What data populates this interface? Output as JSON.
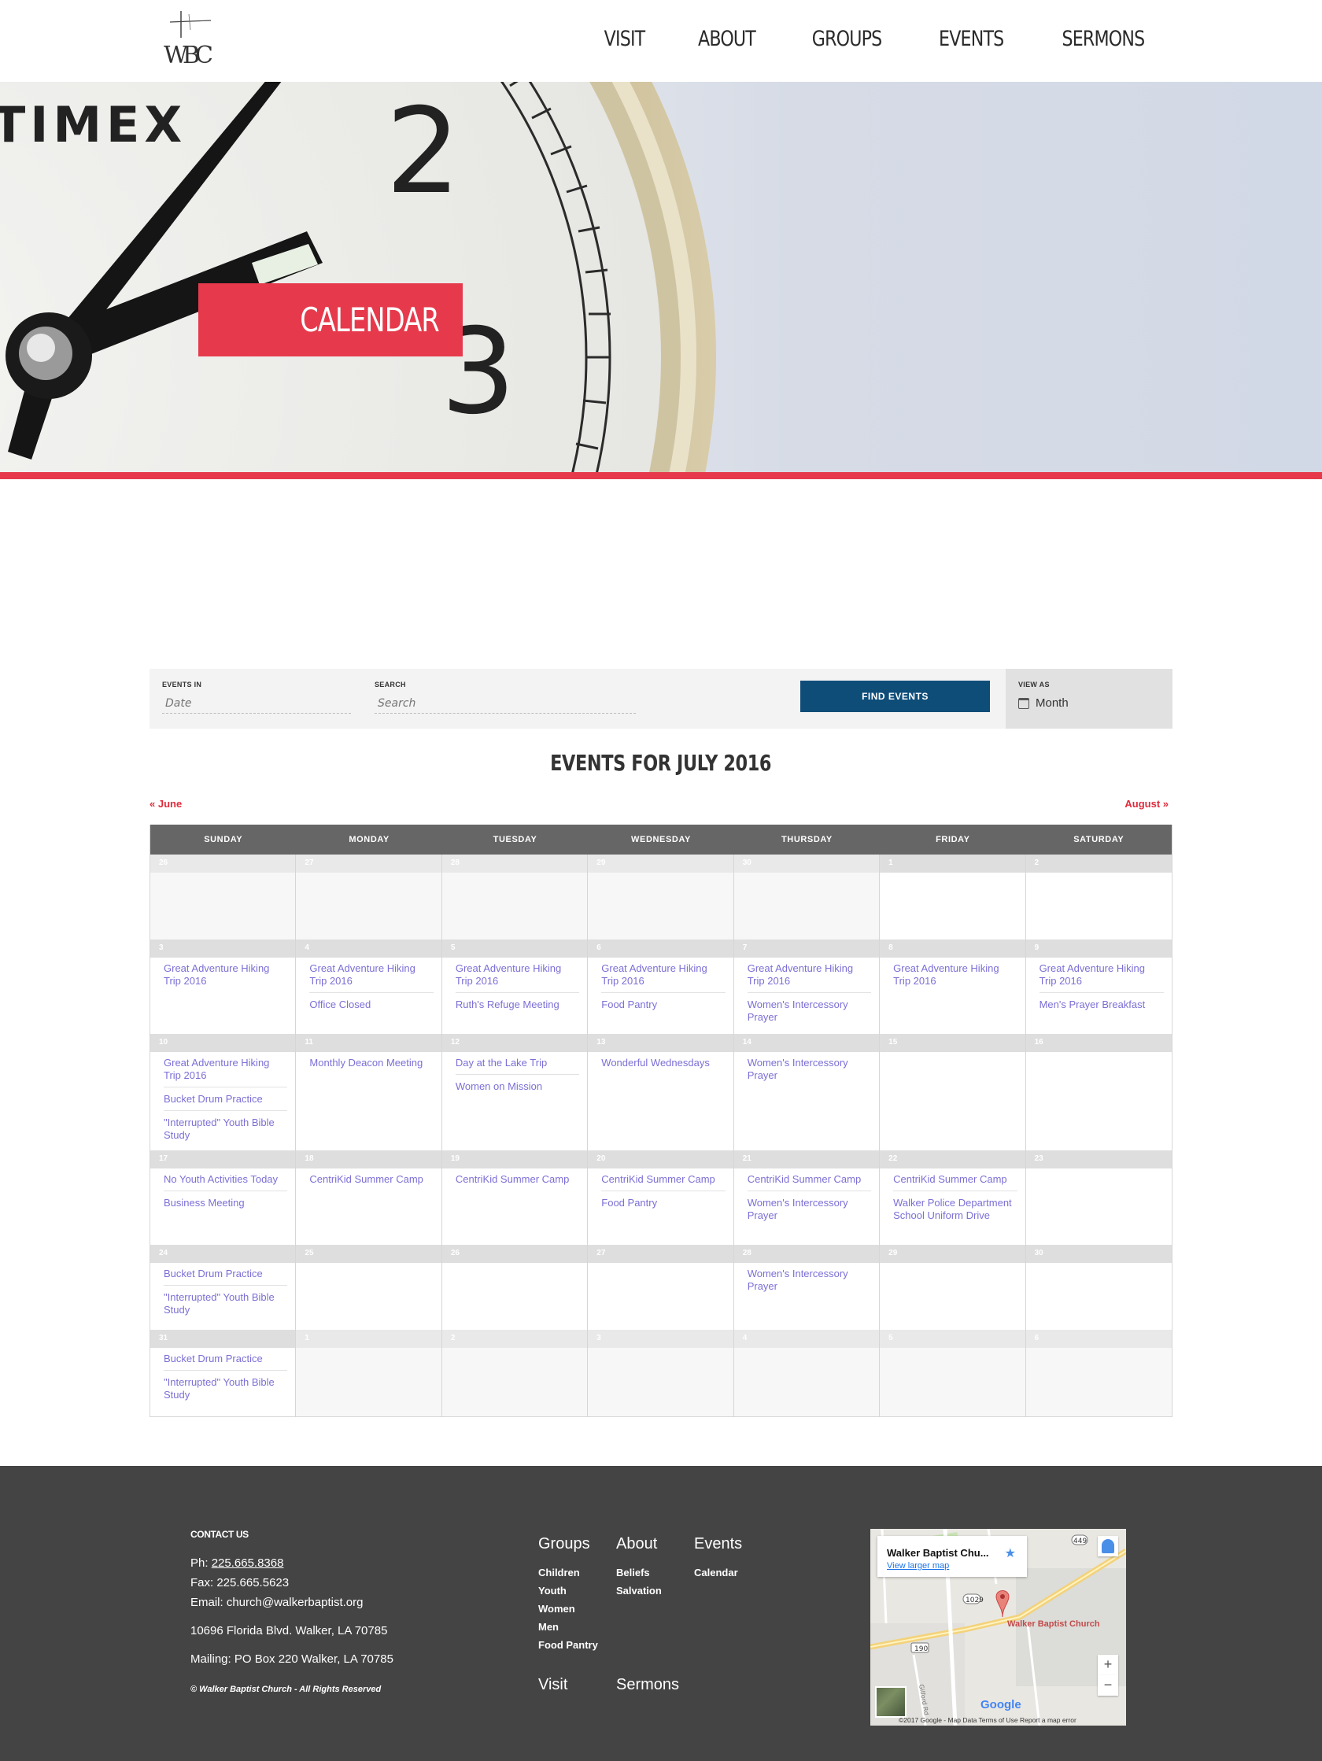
{
  "header": {
    "logo_alt": "WBC",
    "nav": [
      {
        "label": "VISIT"
      },
      {
        "label": "ABOUT"
      },
      {
        "label": "GROUPS"
      },
      {
        "label": "EVENTS"
      },
      {
        "label": "SERMONS"
      }
    ]
  },
  "hero": {
    "title": "CALENDAR",
    "brand_text": "TIMEX",
    "accent": "#e63a4c"
  },
  "filters": {
    "events_in_label": "EVENTS IN",
    "date_placeholder": "Date",
    "search_label": "SEARCH",
    "search_placeholder": "Search",
    "find_label": "FIND EVENTS",
    "view_as_label": "VIEW AS",
    "view_as_value": "Month",
    "button_color": "#0f4d79"
  },
  "calendar": {
    "title": "EVENTS FOR JULY 2016",
    "prev": "« June",
    "next": "August »",
    "weekdays": [
      "SUNDAY",
      "MONDAY",
      "TUESDAY",
      "WEDNESDAY",
      "THURSDAY",
      "FRIDAY",
      "SATURDAY"
    ],
    "weeks": [
      [
        {
          "day": "26",
          "other": true,
          "events": []
        },
        {
          "day": "27",
          "other": true,
          "events": []
        },
        {
          "day": "28",
          "other": true,
          "events": []
        },
        {
          "day": "29",
          "other": true,
          "events": []
        },
        {
          "day": "30",
          "other": true,
          "events": []
        },
        {
          "day": "1",
          "events": []
        },
        {
          "day": "2",
          "events": []
        }
      ],
      [
        {
          "day": "3",
          "events": [
            "Great Adventure Hiking Trip 2016"
          ]
        },
        {
          "day": "4",
          "events": [
            "Great Adventure Hiking Trip 2016",
            "Office Closed"
          ]
        },
        {
          "day": "5",
          "events": [
            "Great Adventure Hiking Trip 2016",
            "Ruth's Refuge Meeting"
          ]
        },
        {
          "day": "6",
          "events": [
            "Great Adventure Hiking Trip 2016",
            "Food Pantry"
          ]
        },
        {
          "day": "7",
          "events": [
            "Great Adventure Hiking Trip 2016",
            "Women's Intercessory Prayer"
          ]
        },
        {
          "day": "8",
          "events": [
            "Great Adventure Hiking Trip 2016"
          ]
        },
        {
          "day": "9",
          "events": [
            "Great Adventure Hiking Trip 2016",
            "Men's Prayer Breakfast"
          ]
        }
      ],
      [
        {
          "day": "10",
          "events": [
            "Great Adventure Hiking Trip 2016",
            "Bucket Drum Practice",
            "\"Interrupted\" Youth Bible Study"
          ]
        },
        {
          "day": "11",
          "events": [
            "Monthly Deacon Meeting"
          ]
        },
        {
          "day": "12",
          "events": [
            "Day at the Lake Trip",
            "Women on Mission"
          ]
        },
        {
          "day": "13",
          "events": [
            "Wonderful Wednesdays"
          ]
        },
        {
          "day": "14",
          "events": [
            "Women's Intercessory Prayer"
          ]
        },
        {
          "day": "15",
          "events": []
        },
        {
          "day": "16",
          "events": []
        }
      ],
      [
        {
          "day": "17",
          "events": [
            "No Youth Activities Today",
            "Business Meeting"
          ]
        },
        {
          "day": "18",
          "events": [
            "CentriKid Summer Camp"
          ]
        },
        {
          "day": "19",
          "events": [
            "CentriKid Summer Camp"
          ]
        },
        {
          "day": "20",
          "events": [
            "CentriKid Summer Camp",
            "Food Pantry"
          ]
        },
        {
          "day": "21",
          "events": [
            "CentriKid Summer Camp",
            "Women's Intercessory Prayer"
          ]
        },
        {
          "day": "22",
          "events": [
            "CentriKid Summer Camp",
            "Walker Police Department School Uniform Drive"
          ]
        },
        {
          "day": "23",
          "events": []
        }
      ],
      [
        {
          "day": "24",
          "events": [
            "Bucket Drum Practice",
            "\"Interrupted\" Youth Bible Study"
          ]
        },
        {
          "day": "25",
          "events": []
        },
        {
          "day": "26",
          "events": []
        },
        {
          "day": "27",
          "events": []
        },
        {
          "day": "28",
          "events": [
            "Women's Intercessory Prayer"
          ]
        },
        {
          "day": "29",
          "events": []
        },
        {
          "day": "30",
          "events": []
        }
      ],
      [
        {
          "day": "31",
          "events": [
            "Bucket Drum Practice",
            "\"Interrupted\" Youth Bible Study"
          ]
        },
        {
          "day": "1",
          "other": true,
          "events": []
        },
        {
          "day": "2",
          "other": true,
          "events": []
        },
        {
          "day": "3",
          "other": true,
          "events": []
        },
        {
          "day": "4",
          "other": true,
          "events": []
        },
        {
          "day": "5",
          "other": true,
          "events": []
        },
        {
          "day": "6",
          "other": true,
          "events": []
        }
      ]
    ]
  },
  "footer": {
    "contact_title": "CONTACT US",
    "phone_label": "Ph: ",
    "phone": "225.665.8368",
    "fax": "Fax: 225.665.5623",
    "email": "Email: church@walkerbaptist.org",
    "address": "10696 Florida Blvd. Walker, LA 70785",
    "mailing": "Mailing: PO Box 220 Walker, LA 70785",
    "copyright": "© Walker Baptist Church - All Rights Reserved",
    "groups": {
      "title": "Groups",
      "links": [
        "Children",
        "Youth",
        "Women",
        "Men",
        "Food Pantry"
      ]
    },
    "about": {
      "title": "About",
      "links": [
        "Beliefs",
        "Salvation"
      ]
    },
    "events": {
      "title": "Events",
      "links": [
        "Calendar"
      ]
    },
    "visit_title": "Visit",
    "sermons_title": "Sermons",
    "map": {
      "place": "Walker Baptist Chu...",
      "view_larger": "View larger map",
      "pin_label": "Walker Baptist Church",
      "road_1029": "1029",
      "road_190": "190",
      "road_449": "449",
      "road_name": "Gilford Rd",
      "zoom_in": "+",
      "zoom_out": "−",
      "google": "Google",
      "attribution": "©2017 Google - Map Data    Terms of Use    Report a map error"
    }
  }
}
